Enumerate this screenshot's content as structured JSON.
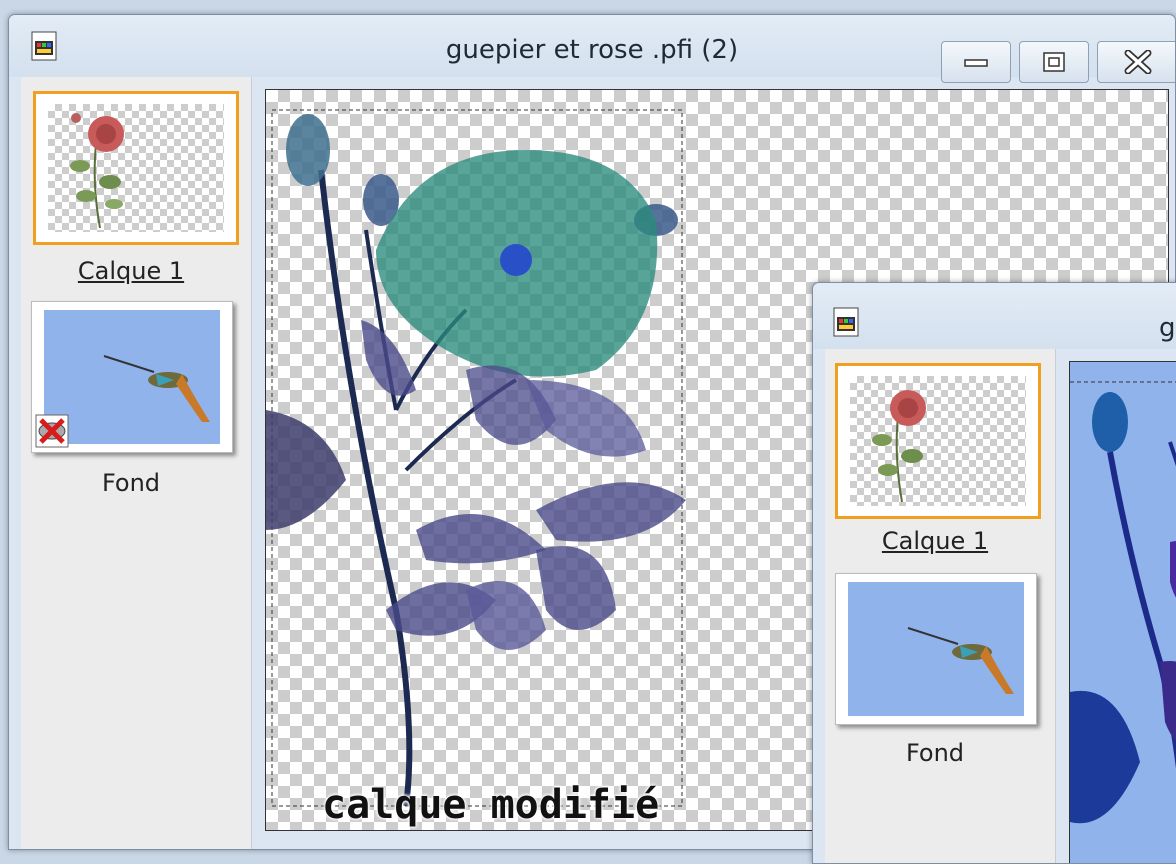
{
  "window_main": {
    "title": "guepier et rose  .pfi (2)",
    "layers": [
      {
        "label": "Calque 1",
        "selected": true
      },
      {
        "label": "Fond",
        "selected": false,
        "hidden_badge": "layer-hidden-icon"
      }
    ],
    "caption": "calque modifié"
  },
  "window_second": {
    "title": "g",
    "layers": [
      {
        "label": "Calque 1",
        "selected": true
      },
      {
        "label": "Fond",
        "selected": false
      }
    ]
  },
  "colors": {
    "selection": "#f0a01e",
    "sky": "#8fb3ea",
    "rose_teal": "#2a8a7c",
    "leaf_purple": "#4a4a8a"
  },
  "icons": {
    "minimize": "minimize-icon",
    "maximize": "maximize-icon",
    "close": "close-icon"
  }
}
